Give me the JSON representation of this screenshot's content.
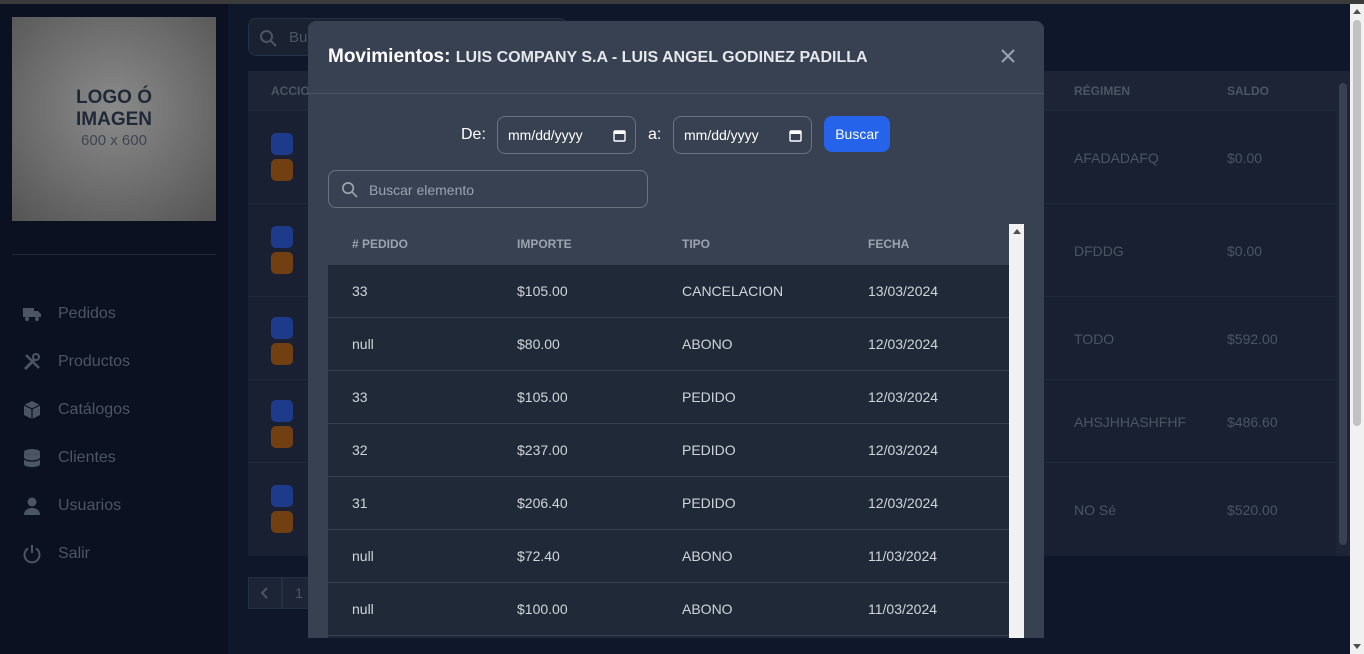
{
  "sidebar": {
    "logo": {
      "line1": "LOGO Ó",
      "line2": "IMAGEN",
      "line3": "600 x 600"
    },
    "items": [
      {
        "label": "Pedidos",
        "icon": "truck-icon"
      },
      {
        "label": "Productos",
        "icon": "tools-icon"
      },
      {
        "label": "Catálogos",
        "icon": "box-icon"
      },
      {
        "label": "Clientes",
        "icon": "database-icon"
      },
      {
        "label": "Usuarios",
        "icon": "user-icon"
      },
      {
        "label": "Salir",
        "icon": "power-icon"
      }
    ]
  },
  "background": {
    "search_placeholder": "Bus",
    "headers": {
      "acciones": "ACCIO",
      "regimen": "RÉGIMEN",
      "saldo": "SALDO"
    },
    "rows": [
      {
        "regimen": "AFADADAFQ",
        "saldo": "$0.00"
      },
      {
        "regimen": "DFDDG",
        "saldo": "$0.00"
      },
      {
        "regimen": "TODO",
        "saldo": "$592.00"
      },
      {
        "regimen": "AHSJHHASHFHF",
        "saldo": "$486.60"
      },
      {
        "regimen": "NO Sé",
        "saldo": "$520.00"
      }
    ],
    "pager": {
      "current": "1"
    }
  },
  "modal": {
    "title_prefix": "Movimientos:",
    "title_company": "LUIS COMPANY S.A - LUIS ANGEL GODINEZ PADILLA",
    "filter": {
      "from_label": "De:",
      "to_label": "a:",
      "from_value": "mm/dd/yyyy",
      "to_value": "mm/dd/yyyy",
      "button": "Buscar"
    },
    "search_placeholder": "Buscar elemento",
    "columns": [
      "# PEDIDO",
      "IMPORTE",
      "TIPO",
      "FECHA"
    ],
    "rows": [
      [
        "33",
        "$105.00",
        "CANCELACION",
        "13/03/2024"
      ],
      [
        "null",
        "$80.00",
        "ABONO",
        "12/03/2024"
      ],
      [
        "33",
        "$105.00",
        "PEDIDO",
        "12/03/2024"
      ],
      [
        "32",
        "$237.00",
        "PEDIDO",
        "12/03/2024"
      ],
      [
        "31",
        "$206.40",
        "PEDIDO",
        "12/03/2024"
      ],
      [
        "null",
        "$72.40",
        "ABONO",
        "11/03/2024"
      ],
      [
        "null",
        "$100.00",
        "ABONO",
        "11/03/2024"
      ]
    ]
  },
  "colors": {
    "accent": "#2563eb",
    "modal_bg": "#374151",
    "table_bg": "#1f2937",
    "page_bg": "#0f172a"
  }
}
